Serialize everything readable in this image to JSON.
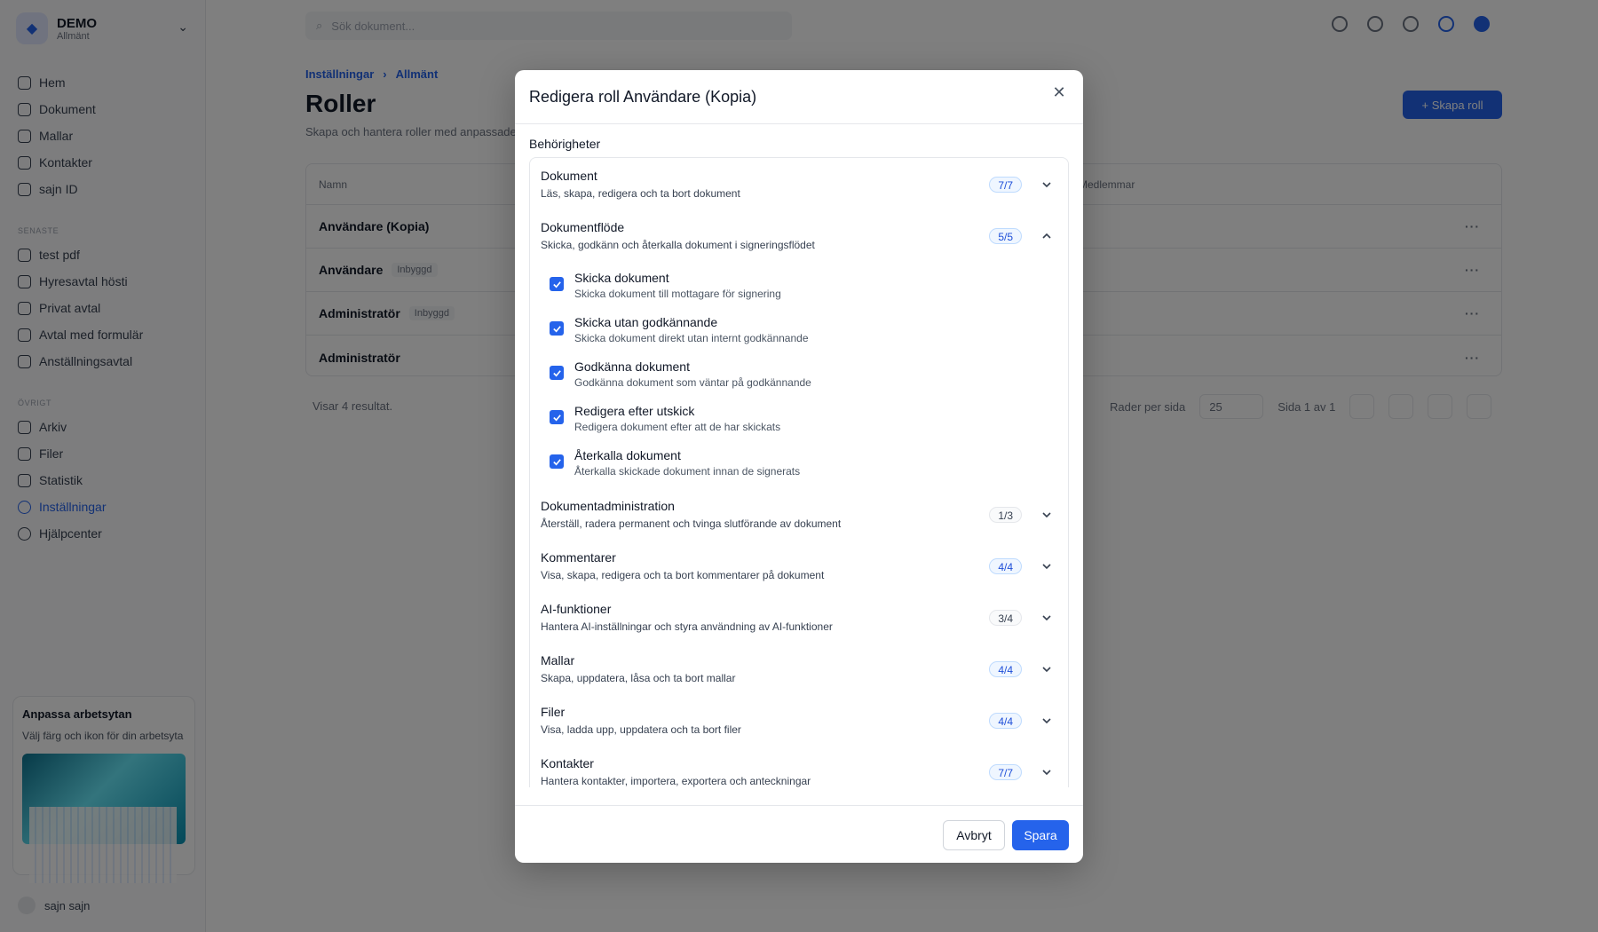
{
  "workspace": {
    "name": "DEMO",
    "sub": "Allmänt"
  },
  "nav": {
    "main": [
      "Hem",
      "Dokument",
      "Mallar",
      "Kontakter",
      "sajn ID"
    ],
    "section_recent": "SENASTE",
    "recent": [
      "test pdf",
      "Hyresavtal hösti",
      "Privat avtal",
      "Avtal med formulär",
      "Anställningsavtal"
    ],
    "section_other": "ÖVRIGT",
    "other": [
      "Arkiv",
      "Filer",
      "Statistik",
      "Inställningar",
      "Hjälpcenter"
    ],
    "active": "Inställningar"
  },
  "promo": {
    "title": "Anpassa arbetsytan",
    "desc": "Välj färg och ikon för din arbetsyta"
  },
  "user": {
    "name": "sajn sajn"
  },
  "search": {
    "placeholder": "Sök dokument..."
  },
  "page": {
    "breadcrumb": [
      "Inställningar",
      "Allmänt"
    ],
    "title": "Roller",
    "subtitle": "Skapa och hantera roller med anpassade behörigheter",
    "create_label": "+ Skapa roll",
    "table": {
      "col_name": "Namn",
      "col_members": "Medlemmar",
      "rows": [
        {
          "name": "Användare (Kopia)",
          "tag": ""
        },
        {
          "name": "Användare",
          "tag": "Inbyggd"
        },
        {
          "name": "Administratör",
          "tag": "Inbyggd"
        },
        {
          "name": "Administratör",
          "tag": ""
        }
      ]
    },
    "results": "Visar 4 resultat.",
    "rows_per_page_label": "Rader per sida",
    "rows_per_page": "25",
    "page_info": "Sida 1 av 1"
  },
  "modal": {
    "title": "Redigera roll Användare (Kopia)",
    "permissions_label": "Behörigheter",
    "groups": [
      {
        "title": "Dokument",
        "desc": "Läs, skapa, redigera och ta bort dokument",
        "count": "7/7",
        "complete": true,
        "expanded": false
      },
      {
        "title": "Dokumentflöde",
        "desc": "Skicka, godkänn och återkalla dokument i signeringsflödet",
        "count": "5/5",
        "complete": true,
        "expanded": true
      },
      {
        "title": "Dokumentadministration",
        "desc": "Återställ, radera permanent och tvinga slutförande av dokument",
        "count": "1/3",
        "complete": false,
        "expanded": false
      },
      {
        "title": "Kommentarer",
        "desc": "Visa, skapa, redigera och ta bort kommentarer på dokument",
        "count": "4/4",
        "complete": true,
        "expanded": false
      },
      {
        "title": "AI-funktioner",
        "desc": "Hantera AI-inställningar och styra användning av AI-funktioner",
        "count": "3/4",
        "complete": false,
        "expanded": false
      },
      {
        "title": "Mallar",
        "desc": "Skapa, uppdatera, låsa och ta bort mallar",
        "count": "4/4",
        "complete": true,
        "expanded": false
      },
      {
        "title": "Filer",
        "desc": "Visa, ladda upp, uppdatera och ta bort filer",
        "count": "4/4",
        "complete": true,
        "expanded": false
      },
      {
        "title": "Kontakter",
        "desc": "Hantera kontakter, importera, exportera och anteckningar",
        "count": "7/7",
        "complete": true,
        "expanded": false
      }
    ],
    "flow_items": [
      {
        "title": "Skicka dokument",
        "desc": "Skicka dokument till mottagare för signering",
        "checked": true
      },
      {
        "title": "Skicka utan godkännande",
        "desc": "Skicka dokument direkt utan internt godkännande",
        "checked": true
      },
      {
        "title": "Godkänna dokument",
        "desc": "Godkänna dokument som väntar på godkännande",
        "checked": true
      },
      {
        "title": "Redigera efter utskick",
        "desc": "Redigera dokument efter att de har skickats",
        "checked": true
      },
      {
        "title": "Återkalla dokument",
        "desc": "Återkalla skickade dokument innan de signerats",
        "checked": true
      }
    ],
    "cancel_label": "Avbryt",
    "save_label": "Spara"
  },
  "colors": {
    "accent": "#2563eb",
    "overlay": "rgba(0,0,0,0.5)"
  }
}
